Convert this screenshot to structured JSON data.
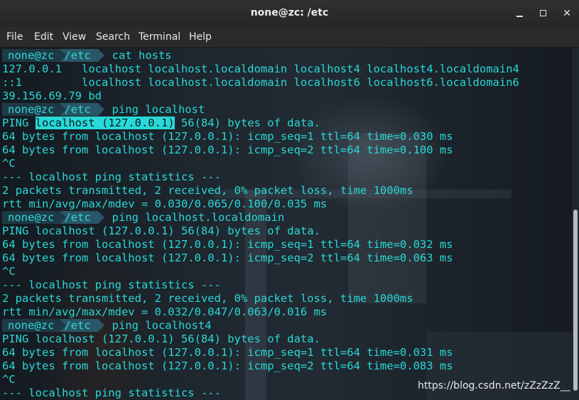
{
  "window": {
    "title": "none@zc: /etc",
    "minimize_icon": "minimize-icon",
    "maximize_icon": "maximize-icon",
    "close_icon": "close-icon"
  },
  "menu": [
    "File",
    "Edit",
    "View",
    "Search",
    "Terminal",
    "Help"
  ],
  "terminal": {
    "prompt_user": "none@zc",
    "prompt_dir": "/etc",
    "highlight_text": "localhost (127.0.0.1)",
    "lines": [
      {
        "type": "prompt",
        "cmd": "cat hosts"
      },
      {
        "type": "out",
        "text": "127.0.0.1   localhost localhost.localdomain localhost4 localhost4.localdomain4"
      },
      {
        "type": "out",
        "text": "::1         localhost localhost.localdomain localhost6 localhost6.localdomain6"
      },
      {
        "type": "out",
        "text": "39.156.69.79 bd"
      },
      {
        "type": "prompt",
        "cmd": "ping localhost"
      },
      {
        "type": "hl",
        "before": "PING ",
        "after": " 56(84) bytes of data."
      },
      {
        "type": "out",
        "text": "64 bytes from localhost (127.0.0.1): icmp_seq=1 ttl=64 time=0.030 ms"
      },
      {
        "type": "out",
        "text": "64 bytes from localhost (127.0.0.1): icmp_seq=2 ttl=64 time=0.100 ms"
      },
      {
        "type": "out",
        "text": "^C"
      },
      {
        "type": "out",
        "text": "--- localhost ping statistics ---"
      },
      {
        "type": "out",
        "text": "2 packets transmitted, 2 received, 0% packet loss, time 1000ms"
      },
      {
        "type": "out",
        "text": "rtt min/avg/max/mdev = 0.030/0.065/0.100/0.035 ms"
      },
      {
        "type": "prompt",
        "cmd": "ping localhost.localdomain"
      },
      {
        "type": "out",
        "text": "PING localhost (127.0.0.1) 56(84) bytes of data."
      },
      {
        "type": "out",
        "text": "64 bytes from localhost (127.0.0.1): icmp_seq=1 ttl=64 time=0.032 ms"
      },
      {
        "type": "out",
        "text": "64 bytes from localhost (127.0.0.1): icmp_seq=2 ttl=64 time=0.063 ms"
      },
      {
        "type": "out",
        "text": "^C"
      },
      {
        "type": "out",
        "text": "--- localhost ping statistics ---"
      },
      {
        "type": "out",
        "text": "2 packets transmitted, 2 received, 0% packet loss, time 1000ms"
      },
      {
        "type": "out",
        "text": "rtt min/avg/max/mdev = 0.032/0.047/0.063/0.016 ms"
      },
      {
        "type": "prompt",
        "cmd": "ping localhost4"
      },
      {
        "type": "out",
        "text": "PING localhost (127.0.0.1) 56(84) bytes of data."
      },
      {
        "type": "out",
        "text": "64 bytes from localhost (127.0.0.1): icmp_seq=1 ttl=64 time=0.031 ms"
      },
      {
        "type": "out",
        "text": "64 bytes from localhost (127.0.0.1): icmp_seq=2 ttl=64 time=0.083 ms"
      },
      {
        "type": "out",
        "text": "^C"
      },
      {
        "type": "out",
        "text": "--- localhost ping statistics ---"
      }
    ]
  },
  "watermark": "https://blog.csdn.net/zZzZzZ__",
  "colors": {
    "text": "#29d8d8",
    "prompt_user_bg": "#1e3a45",
    "prompt_dir_bg": "#2a5767"
  }
}
